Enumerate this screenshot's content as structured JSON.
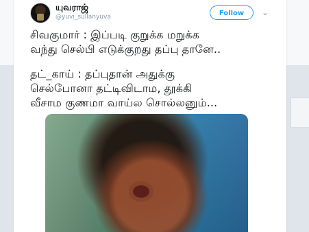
{
  "tweet": {
    "display_name": "யுவராஜ்",
    "handle": "@yuvi_sullanyuva",
    "follow_label": "Follow",
    "more_icon": "chevron-down-icon",
    "lines": [
      "சிவகுமார் : இப்படி குறுக்க மறுக்க",
      "வந்து செல்பி எடுக்குறது தப்பு தானே..",
      "தட்_காய் : தப்புதான் அதுக்கு",
      "செல்போனா தட்டிவிடாம, தூக்கி",
      "வீசாம குணமா வாய்ல சொல்லனும்..."
    ]
  }
}
